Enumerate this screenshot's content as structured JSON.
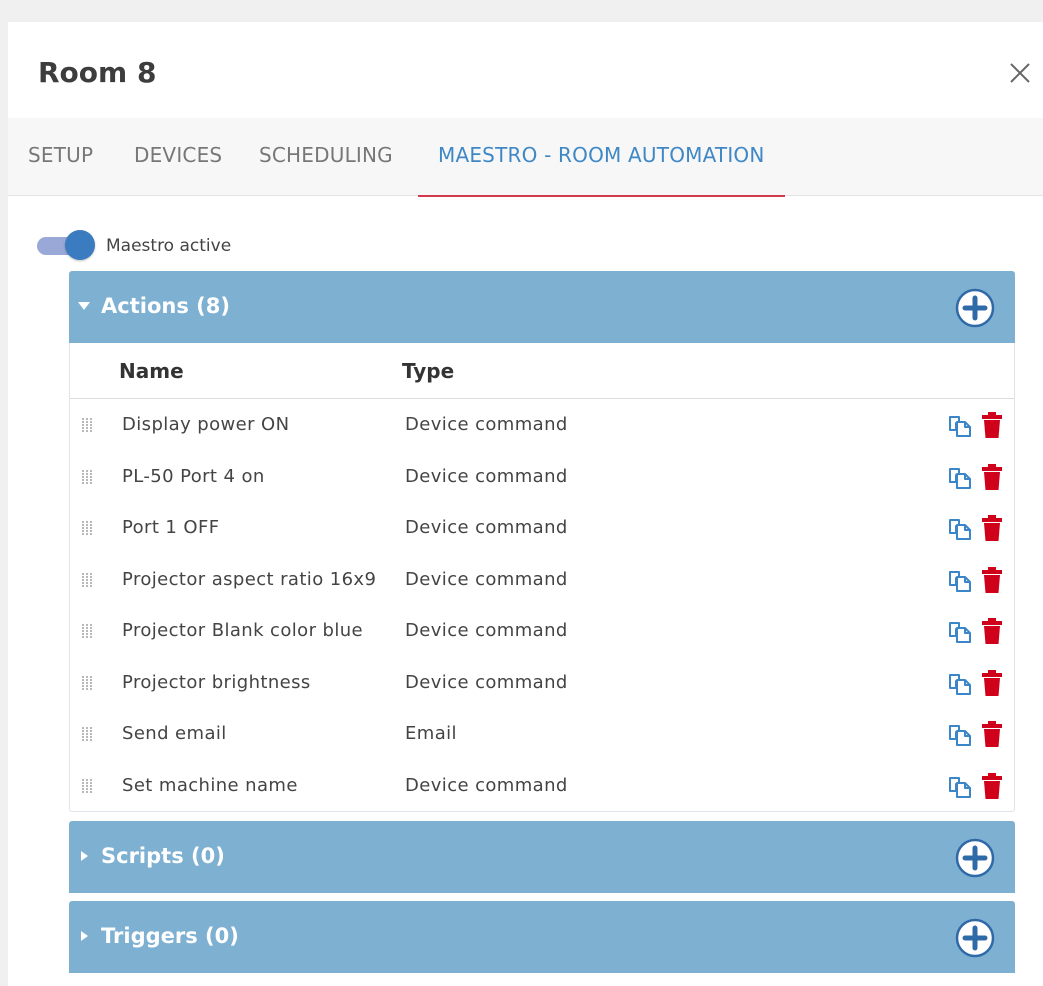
{
  "dialog": {
    "title": "Room 8"
  },
  "tabs": [
    {
      "label": "SETUP",
      "active": false
    },
    {
      "label": "DEVICES",
      "active": false
    },
    {
      "label": "SCHEDULING",
      "active": false
    },
    {
      "label": "MAESTRO - ROOM AUTOMATION",
      "active": true
    }
  ],
  "maestro": {
    "toggle_label": "Maestro active",
    "active": true
  },
  "actions": {
    "title": "Actions (8)",
    "expanded": true,
    "columns": {
      "name": "Name",
      "type": "Type"
    },
    "rows": [
      {
        "name": "Display power ON",
        "type": "Device command"
      },
      {
        "name": "PL-50 Port 4 on",
        "type": "Device command"
      },
      {
        "name": "Port 1 OFF",
        "type": "Device command"
      },
      {
        "name": "Projector aspect ratio 16x9",
        "type": "Device command"
      },
      {
        "name": "Projector Blank color blue",
        "type": "Device command"
      },
      {
        "name": "Projector brightness",
        "type": "Device command"
      },
      {
        "name": "Send email",
        "type": "Email"
      },
      {
        "name": "Set machine name",
        "type": "Device command"
      }
    ]
  },
  "scripts": {
    "title": "Scripts (0)",
    "expanded": false
  },
  "triggers": {
    "title": "Triggers (0)",
    "expanded": false
  },
  "icons": {
    "close": "close-icon",
    "caret_down": "caret-down-icon",
    "caret_right": "caret-right-icon",
    "add": "plus-circle-icon",
    "grip": "drag-handle-icon",
    "copy": "copy-icon",
    "delete": "trash-icon"
  },
  "colors": {
    "panel_header": "#7eb0d2",
    "active_tab_text": "#3f88c5",
    "active_tab_underline": "#d03a4c",
    "toggle_knob": "#3b7bbf",
    "toggle_track": "#9aa8d8",
    "copy_icon": "#3a86c8",
    "delete_icon": "#d0021b"
  }
}
